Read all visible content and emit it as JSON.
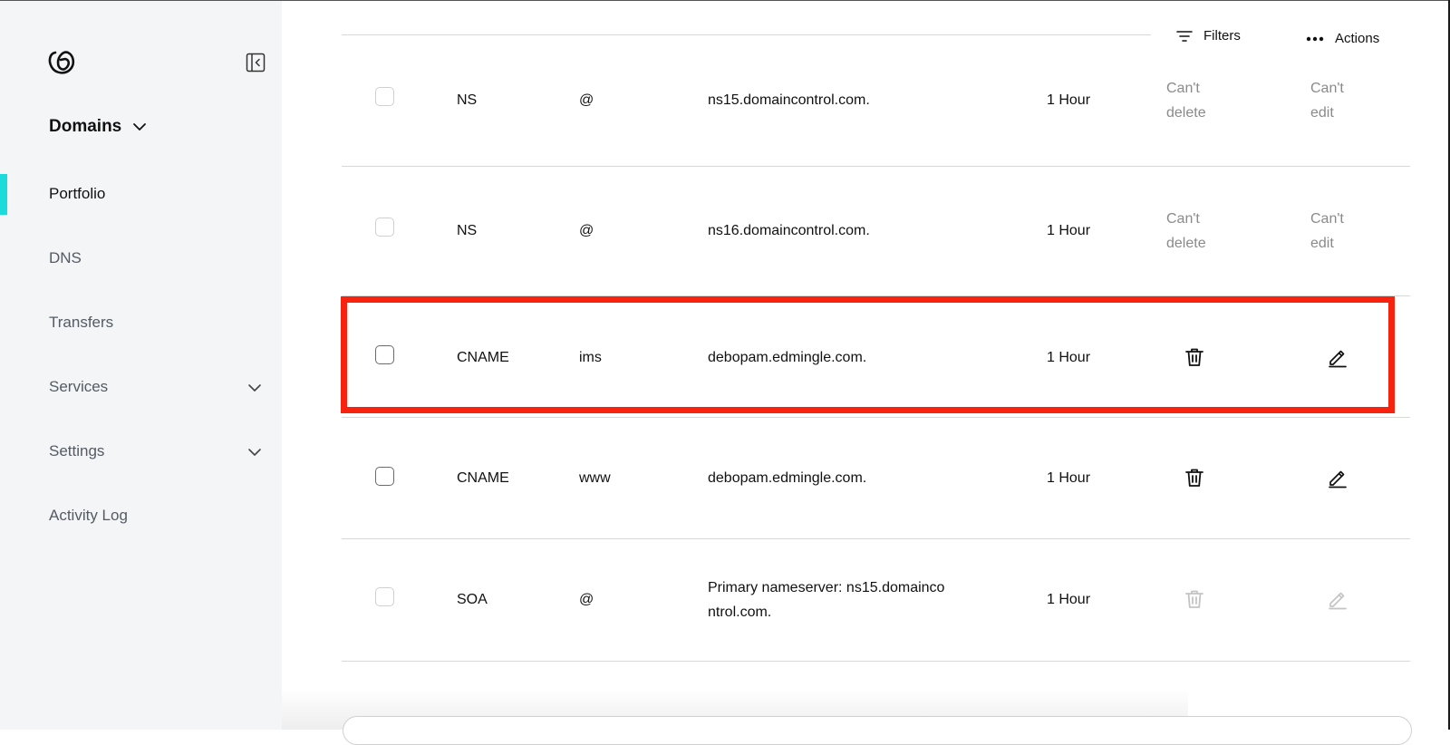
{
  "sidebar": {
    "logo_icon": "godaddy-logo-icon",
    "collapse_icon": "sidebar-collapse-icon",
    "section": "Domains",
    "items": [
      {
        "label": "Portfolio",
        "active": true
      },
      {
        "label": "DNS"
      },
      {
        "label": "Transfers"
      },
      {
        "label": "Services",
        "expandable": true
      },
      {
        "label": "Settings",
        "expandable": true
      },
      {
        "label": "Activity Log"
      }
    ],
    "accent_color": "#1bdbdb"
  },
  "toolbar": {
    "filters_label": "Filters",
    "actions_label": "Actions"
  },
  "records": [
    {
      "type": "NS",
      "name": "@",
      "value": "ns15.domaincontrol.com.",
      "ttl": "1 Hour",
      "delete_text": "Can't delete",
      "edit_text": "Can't edit"
    },
    {
      "type": "NS",
      "name": "@",
      "value": "ns16.domaincontrol.com.",
      "ttl": "1 Hour",
      "delete_text": "Can't delete",
      "edit_text": "Can't edit"
    },
    {
      "type": "CNAME",
      "name": "ims",
      "value": "debopam.edmingle.com.",
      "ttl": "1 Hour",
      "highlighted": true
    },
    {
      "type": "CNAME",
      "name": "www",
      "value": "debopam.edmingle.com.",
      "ttl": "1 Hour"
    },
    {
      "type": "SOA",
      "name": "@",
      "value": "Primary nameserver: ns15.domainco\nntrol.com.",
      "ttl": "1 Hour",
      "actions_disabled": true
    }
  ],
  "highlight_color": "#f8230f"
}
